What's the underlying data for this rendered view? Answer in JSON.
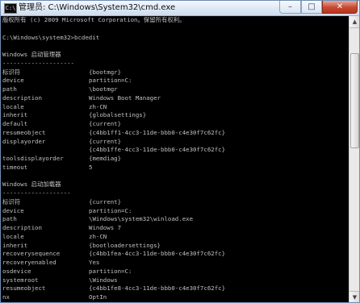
{
  "window": {
    "title": "管理员: C:\\Windows\\System32\\cmd.exe",
    "icon_label": "C:\\",
    "minimize_label": "–",
    "maximize_label": "□",
    "close_label": "✕"
  },
  "console": {
    "header_line": "版权所有 (c) 2009 Microsoft Corporation。保留所有权利。",
    "prompt_line": "C:\\Windows\\system32>bcdedit",
    "boot_manager": {
      "heading": "Windows 启动管理器",
      "rule": "--------------------",
      "id_key": "标识符",
      "id_value": "{bootmgr}",
      "entries": [
        {
          "key": "device",
          "value": "partition=C:"
        },
        {
          "key": "path",
          "value": "\\bootmgr"
        },
        {
          "key": "description",
          "value": "Windows Boot Manager"
        },
        {
          "key": "locale",
          "value": "zh-CN"
        },
        {
          "key": "inherit",
          "value": "{globalsettings}"
        },
        {
          "key": "default",
          "value": "{current}"
        },
        {
          "key": "resumeobject",
          "value": "{c4bb1ff1-4cc3-11de-bbb0-c4e30f7c62fc}"
        },
        {
          "key": "displayorder",
          "value": "{current}"
        },
        {
          "key": "",
          "value": "{c4bb1ffe-4cc3-11de-bbb0-c4e30f7c62fc}"
        },
        {
          "key": "toolsdisplayorder",
          "value": "{memdiag}"
        },
        {
          "key": "timeout",
          "value": "5"
        }
      ]
    },
    "boot_loader": {
      "heading": "Windows 启动加载器",
      "rule": "-------------------",
      "id_key": "标识符",
      "id_value": "{current}",
      "entries": [
        {
          "key": "device",
          "value": "partition=C:"
        },
        {
          "key": "path",
          "value": "\\Windows\\system32\\winload.exe"
        },
        {
          "key": "description",
          "value": "Windows 7"
        },
        {
          "key": "locale",
          "value": "zh-CN"
        },
        {
          "key": "inherit",
          "value": "{bootloadersettings}"
        },
        {
          "key": "recoverysequence",
          "value": "{c4bb1fea-4cc3-11de-bbb0-c4e30f7c62fc}"
        },
        {
          "key": "recoveryenabled",
          "value": "Yes"
        },
        {
          "key": "osdevice",
          "value": "partition=C:"
        },
        {
          "key": "systemroot",
          "value": "\\Windows"
        },
        {
          "key": "resumeobject",
          "value": "{c4bb1fe8-4cc3-11de-bbb0-c4e30f7c62fc}"
        },
        {
          "key": "nx",
          "value": "OptIn"
        }
      ]
    }
  },
  "scrollbar": {
    "up_label": "▲",
    "down_label": "▼"
  }
}
